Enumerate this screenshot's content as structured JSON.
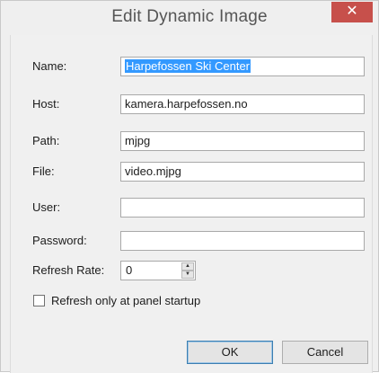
{
  "window": {
    "title": "Edit Dynamic Image",
    "close_glyph": "✕"
  },
  "fields": [
    {
      "label": "Name:",
      "value": "Harpefossen Ski Center",
      "selected": true
    },
    {
      "label": "Host:",
      "value": "kamera.harpefossen.no"
    },
    {
      "label": "Path:",
      "value": "mjpg"
    },
    {
      "label": "File:",
      "value": "video.mjpg"
    },
    {
      "label": "User:",
      "value": ""
    },
    {
      "label": "Password:",
      "value": ""
    }
  ],
  "refresh": {
    "label": "Refresh Rate:",
    "value": "0"
  },
  "checkbox": {
    "label": "Refresh only at panel startup",
    "checked": false
  },
  "buttons": {
    "ok": "OK",
    "cancel": "Cancel"
  },
  "colors": {
    "selection": "#3399ff",
    "close_button": "#c7504b"
  }
}
